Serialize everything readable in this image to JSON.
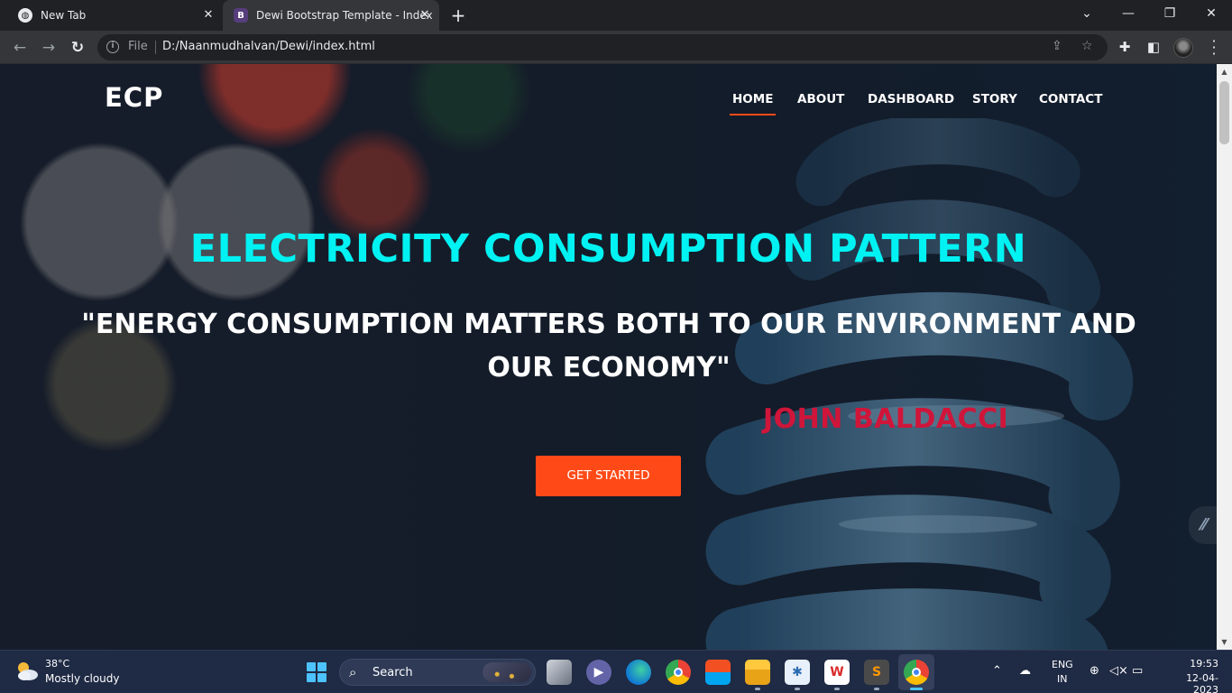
{
  "browser": {
    "tabs": [
      {
        "title": "New Tab",
        "favicon": "globe-icon"
      },
      {
        "title": "Dewi Bootstrap Template - Index",
        "favicon": "bootstrap-icon",
        "favicon_letter": "B"
      }
    ],
    "new_tab_symbol": "+",
    "window_controls": {
      "chevron": "⌄",
      "minimize": "—",
      "restore": "❐",
      "close": "✕"
    },
    "address": {
      "scheme_label": "File",
      "url": "D:/Naanmudhalvan/Dewi/index.html"
    }
  },
  "site": {
    "brand": "ECP",
    "nav": [
      {
        "label": "HOME",
        "active": true
      },
      {
        "label": "ABOUT",
        "active": false
      },
      {
        "label": "DASHBOARD",
        "active": false
      },
      {
        "label": "STORY",
        "active": false
      },
      {
        "label": "CONTACT",
        "active": false
      }
    ],
    "hero": {
      "title": "ELECTRICITY CONSUMPTION PATTERN",
      "quote": "\"ENERGY CONSUMPTION MATTERS BOTH TO OUR ENVIRONMENT AND OUR ECONOMY\"",
      "author": "JOHN BALDACCI",
      "cta": "GET STARTED"
    },
    "colors": {
      "accent": "#ff4a17",
      "title": "#00f2f2",
      "author": "#d0153a"
    }
  },
  "taskbar": {
    "weather": {
      "temp": "38°C",
      "desc": "Mostly cloudy"
    },
    "search_label": "Search",
    "language": {
      "line1": "ENG",
      "line2": "IN"
    },
    "time": "19:53",
    "date": "12-04-2023"
  }
}
